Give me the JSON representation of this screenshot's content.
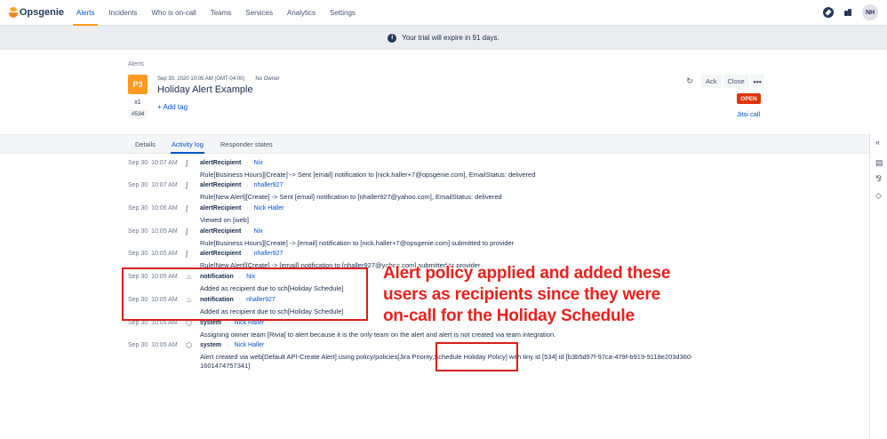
{
  "brand": {
    "name": "Opsgenie"
  },
  "nav": {
    "items": [
      {
        "label": "Alerts",
        "active": true
      },
      {
        "label": "Incidents"
      },
      {
        "label": "Who is on-call"
      },
      {
        "label": "Teams"
      },
      {
        "label": "Services"
      },
      {
        "label": "Analytics"
      },
      {
        "label": "Settings"
      }
    ],
    "avatar_initials": "NH"
  },
  "trial_banner": {
    "text": "Your trial will expire in 91 days."
  },
  "alert": {
    "breadcrumb": "Alerts",
    "priority": "P3",
    "count": "x1",
    "tiny_id": "#534",
    "created": "Sep 30, 2020 10:05 AM (GMT-04:00)",
    "owner": "No Owner",
    "title": "Holiday Alert Example",
    "add_tag": "+ Add tag",
    "ack_label": "Ack",
    "close_label": "Close",
    "more_label": "•••",
    "status": "OPEN",
    "jitsi": "Jitsi call"
  },
  "tabs": [
    {
      "label": "Details"
    },
    {
      "label": "Activity log",
      "active": true
    },
    {
      "label": "Responder states"
    }
  ],
  "log": [
    {
      "date": "Sep 30",
      "time": "10:07 AM",
      "source": "alertRecipient",
      "user": "Nix",
      "message": "Rule[Business Hours][Create] -> Sent [email] notification to [nick.haller+7@opsgenie.com], EmailStatus: delivered"
    },
    {
      "date": "Sep 30",
      "time": "10:07 AM",
      "source": "alertRecipient",
      "user": "nhaller927",
      "message": "Rule[New Alert][Create] -> Sent [email] notification to [nhaller927@yahoo.com], EmailStatus: delivered"
    },
    {
      "date": "Sep 30",
      "time": "10:06 AM",
      "source": "alertRecipient",
      "user": "Nick Haller",
      "message": "Viewed on [web]"
    },
    {
      "date": "Sep 30",
      "time": "10:05 AM",
      "source": "alertRecipient",
      "user": "Nix",
      "message": "Rule[Business Hours][Create] -> [email] notification to [nick.haller+7@opsgenie.com] submitted to provider"
    },
    {
      "date": "Sep 30",
      "time": "10:05 AM",
      "source": "alertRecipient",
      "user": "nhaller927",
      "message": "Rule[New Alert][Create] -> [email] notification to [nhaller927@yahoo.com] submitted to provider"
    },
    {
      "date": "Sep 30",
      "time": "10:05 AM",
      "source": "notification",
      "user": "Nix",
      "message": "Added as recipient due to sch[Holiday Schedule]"
    },
    {
      "date": "Sep 30",
      "time": "10:05 AM",
      "source": "notification",
      "user": "nhaller927",
      "message": "Added as recipient due to sch[Holiday Schedule]"
    },
    {
      "date": "Sep 30",
      "time": "10:05 AM",
      "source": "system",
      "user": "Nick Haller",
      "message": "Assigning owner team [Rivia] to alert because it is the only team on the alert and alert is not created via team integration."
    },
    {
      "date": "Sep 30",
      "time": "10:05 AM",
      "source": "system",
      "user": "Nick Haller",
      "message": "Alert created via web[Default API-Create Alert] using policy/policies[Jira Priority,Schedule Holiday Policy] with tiny id [534] id [b3b5d97f-97ca-479f-b919-9118e203d360-",
      "message2": "1601474757341]"
    }
  ],
  "annotation": {
    "line1": "Alert policy applied and added these",
    "line2": "users as recipients since they were",
    "line3": "on-call for the Holiday Schedule"
  },
  "colors": {
    "accent": "#0052cc",
    "priority": "#ff991f",
    "open": "#de350b",
    "annotation": "#e8211d"
  }
}
